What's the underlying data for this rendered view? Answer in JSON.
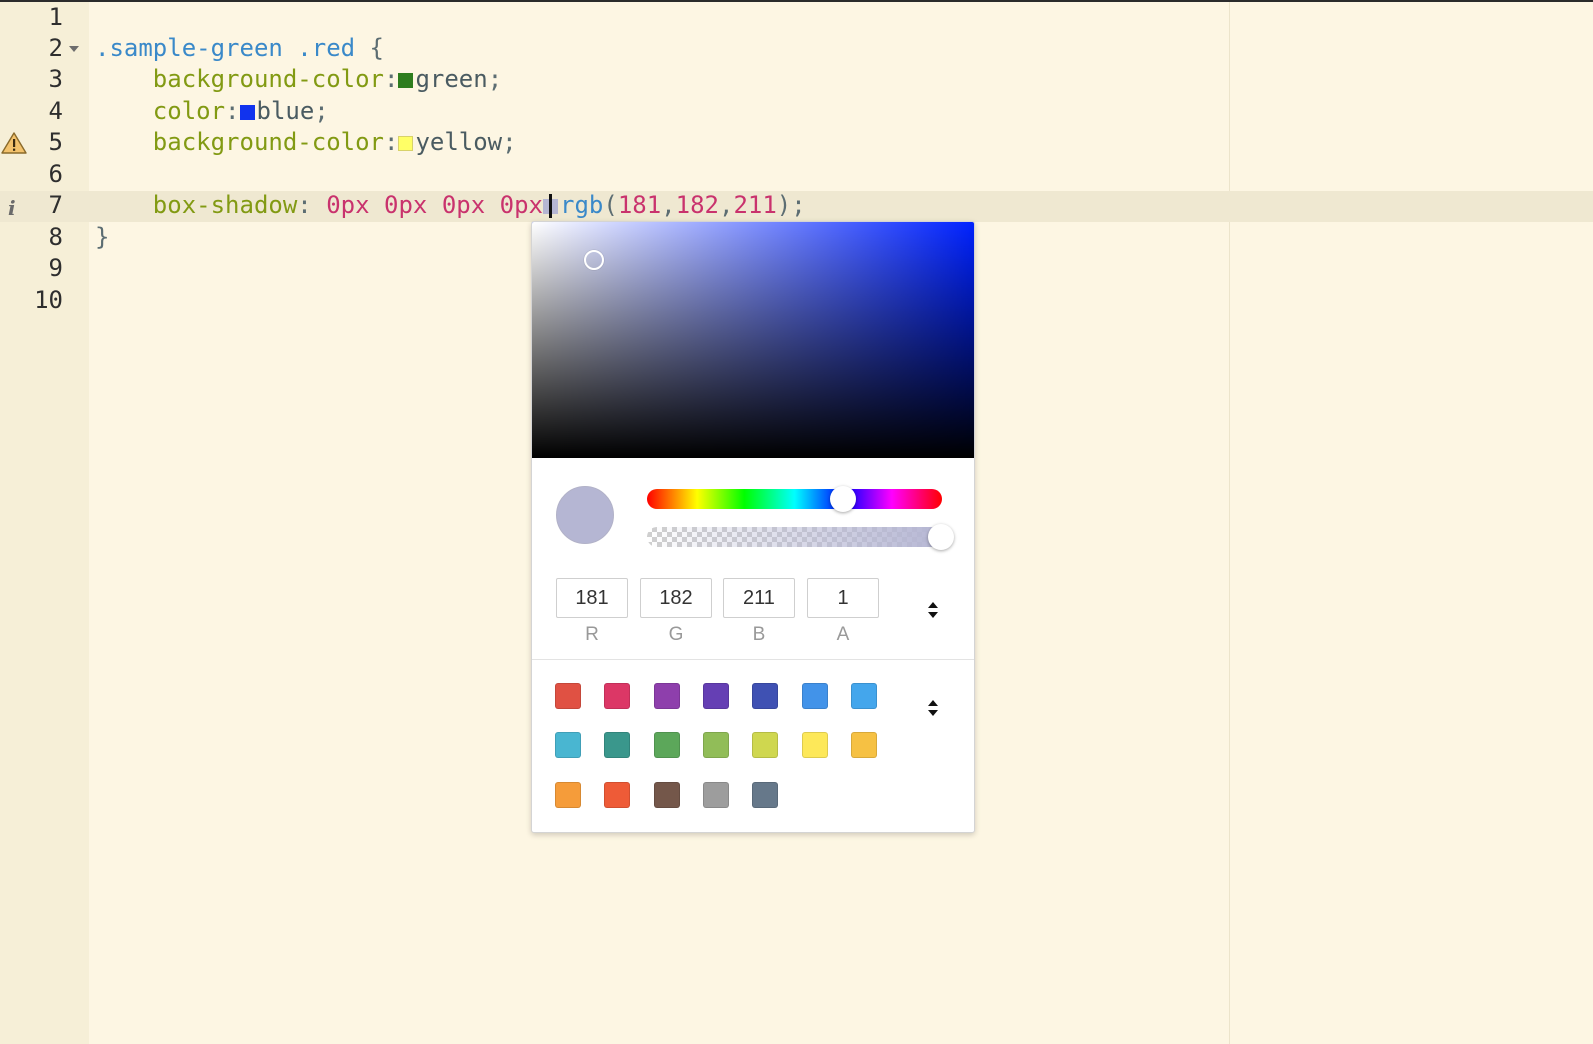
{
  "editor": {
    "line_numbers": [
      "1",
      "2",
      "3",
      "4",
      "5",
      "6",
      "7",
      "8",
      "9",
      "10"
    ],
    "active_line": 7,
    "lines": {
      "l2": {
        "selector": ".sample-green .red",
        "brace": " {"
      },
      "l3": {
        "indent": "    ",
        "prop": "background-color",
        "colon": ":",
        "value": "green",
        "semi": ";"
      },
      "l4": {
        "indent": "    ",
        "prop": "color",
        "colon": ":",
        "value": "blue",
        "semi": ";"
      },
      "l5": {
        "indent": "    ",
        "prop": "background-color",
        "colon": ":",
        "value": "yellow",
        "semi": ";"
      },
      "l7": {
        "indent": "    ",
        "prop": "box-shadow",
        "colon": ": ",
        "n1": "0px",
        "n2": "0px",
        "n3": "0px",
        "n4": "0px",
        "fn": "rgb",
        "open": "(",
        "r": "181",
        "c1": ",",
        "g": "182",
        "c2": ",",
        "b": "211",
        "close": ");"
      },
      "l8": {
        "brace": "}"
      }
    },
    "inline_swatches": {
      "green": "#2e7d1e",
      "blue": "#1133ee",
      "yellow": "#ffff66",
      "rgb": "#b5b6d3"
    },
    "gutter_icons": {
      "line5": "warning-icon",
      "line7": "info-icon"
    },
    "info_glyph": "i"
  },
  "color_picker": {
    "current_color": "#b5b6d3",
    "hue_color": "#0022ff",
    "hue_fraction": 0.66,
    "alpha": 1,
    "channels": [
      {
        "label": "R",
        "value": "181"
      },
      {
        "label": "G",
        "value": "182"
      },
      {
        "label": "B",
        "value": "211"
      },
      {
        "label": "A",
        "value": "1"
      }
    ],
    "format_toggle_icon": "up-down-arrows-icon",
    "palette_toggle_icon": "up-down-arrows-icon",
    "palette": [
      "#e05143",
      "#dc3766",
      "#8e3fac",
      "#653fb4",
      "#3f51b3",
      "#4293e9",
      "#44a6ec",
      "#49b6d1",
      "#3a978c",
      "#5ca75a",
      "#91bd58",
      "#cfd74f",
      "#fde859",
      "#f6c143",
      "#f59c3a",
      "#ee5b37",
      "#74574a",
      "#9d9d9d",
      "#66788a"
    ]
  }
}
